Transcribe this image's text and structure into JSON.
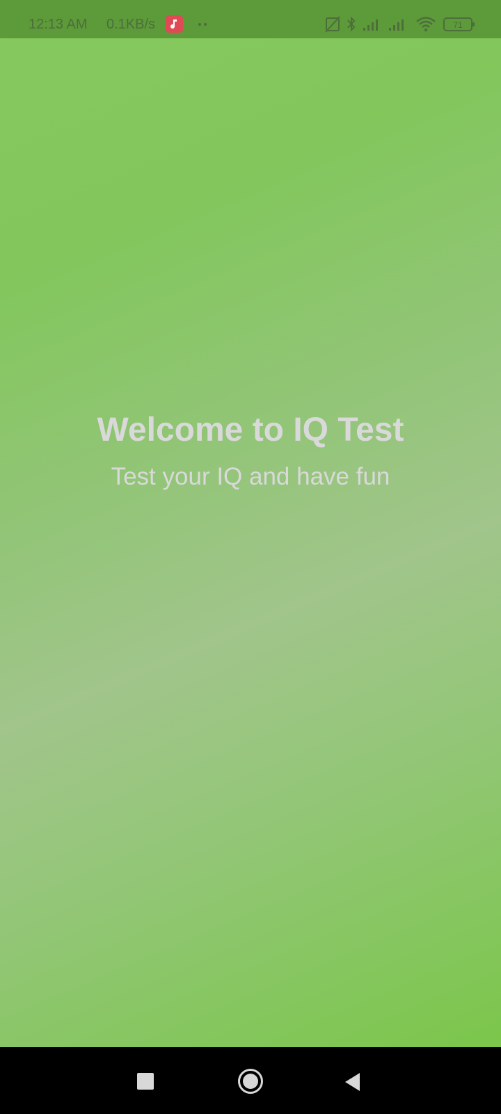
{
  "status_bar": {
    "time": "12:13 AM",
    "speed": "0.1KB/s",
    "battery": "71",
    "icons": [
      "music-app-icon",
      "more-dots-icon",
      "no-sim-icon",
      "bluetooth-icon",
      "signal-icon",
      "signal-icon",
      "wifi-icon",
      "battery-icon"
    ]
  },
  "main": {
    "title": "Welcome to IQ Test",
    "subtitle": "Test your IQ and have fun"
  },
  "nav_bar": {
    "buttons": [
      "recents-button",
      "home-button",
      "back-button"
    ]
  },
  "colors": {
    "background_green": "#7bc64b",
    "text": "#d9d9d9",
    "status_bar": "#5d9a3a"
  }
}
